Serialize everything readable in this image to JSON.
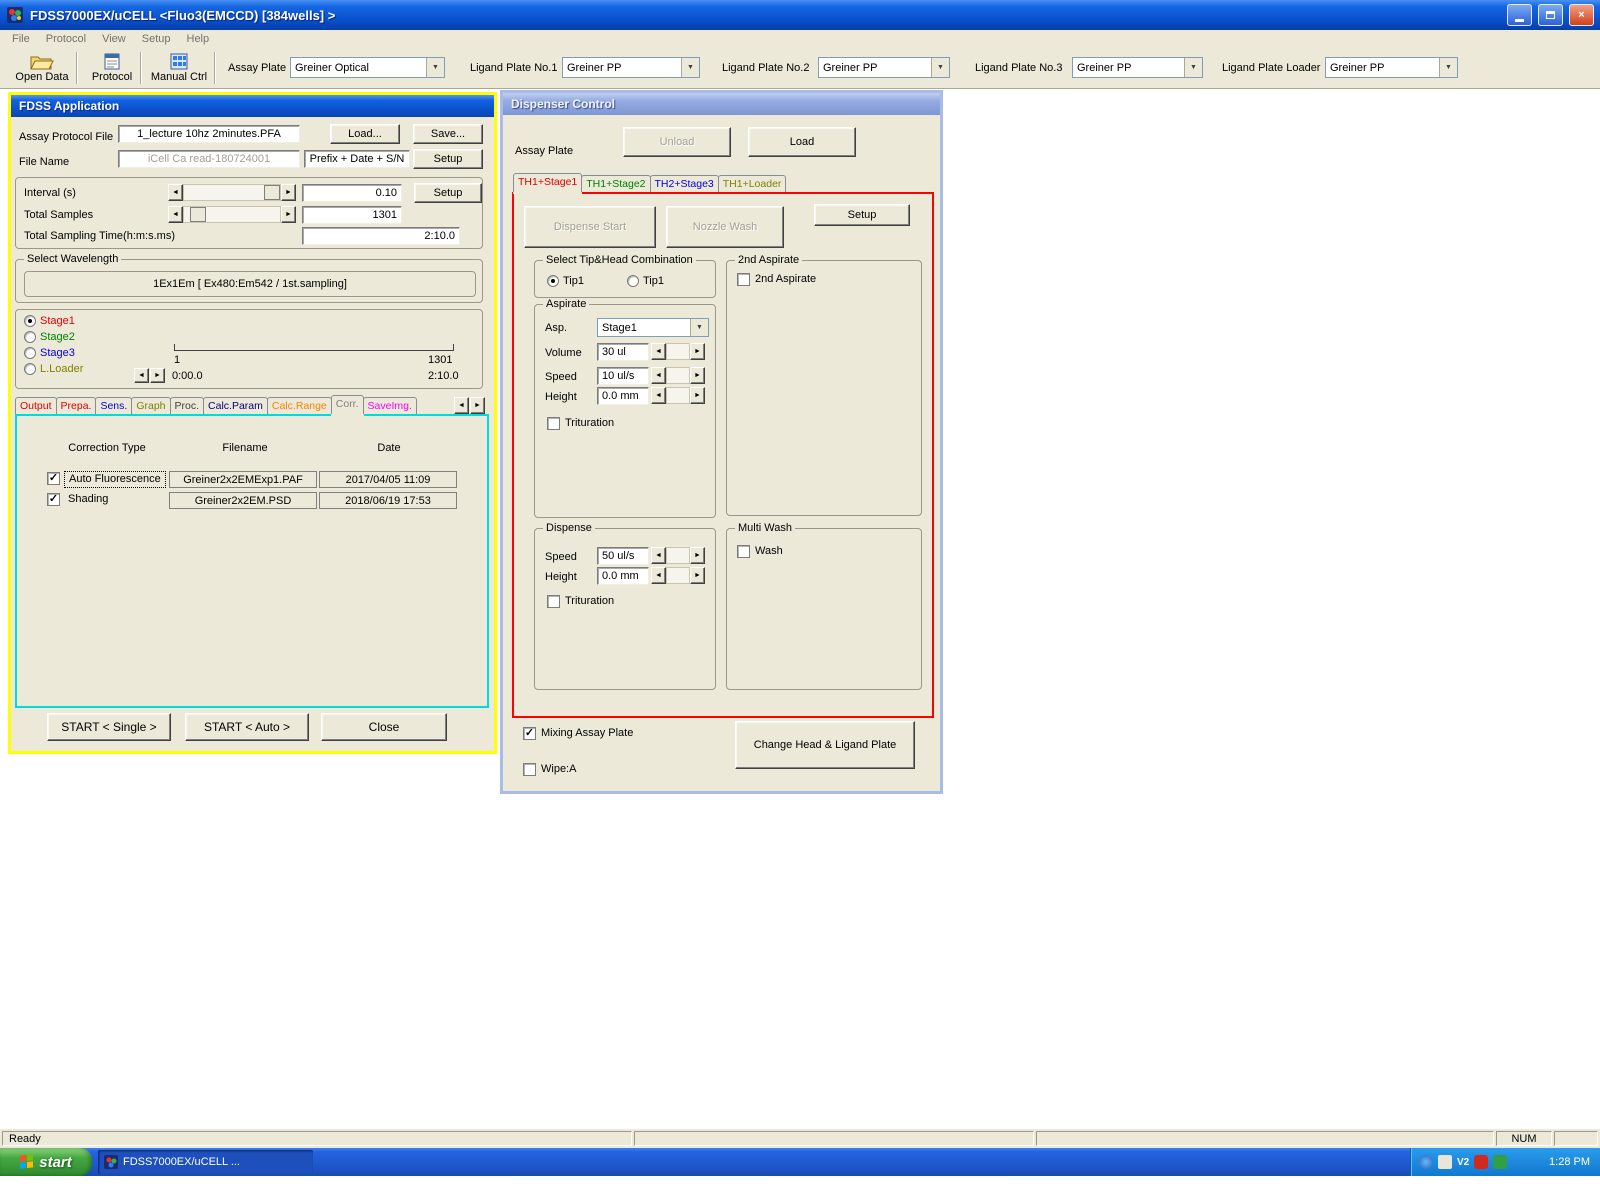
{
  "titlebar": {
    "title": "FDSS7000EX/uCELL <Fluo3(EMCCD) [384wells] >"
  },
  "menubar": {
    "items": [
      "File",
      "Protocol",
      "View",
      "Setup",
      "Help"
    ]
  },
  "toolbar": {
    "open_data": "Open Data",
    "protocol": "Protocol",
    "manual_ctrl": "Manual Ctrl",
    "combos": [
      {
        "label": "Assay Plate",
        "value": "Greiner Optical"
      },
      {
        "label": "Ligand Plate No.1",
        "value": "Greiner PP"
      },
      {
        "label": "Ligand Plate No.2",
        "value": "Greiner PP"
      },
      {
        "label": "Ligand Plate No.3",
        "value": "Greiner PP"
      },
      {
        "label": "Ligand Plate Loader",
        "value": "Greiner PP"
      }
    ]
  },
  "fdss": {
    "title": "FDSS Application",
    "protocol_file": {
      "label": "Assay Protocol File",
      "value": "1_lecture 10hz 2minutes.PFA",
      "load": "Load...",
      "save": "Save..."
    },
    "file_name": {
      "label": "File Name",
      "value": "iCell Ca read-180724001",
      "prefix": "Prefix + Date + S/N",
      "setup": "Setup"
    },
    "interval": {
      "label": "Interval (s)",
      "value": "0.10",
      "setup": "Setup"
    },
    "total_samples": {
      "label": "Total Samples",
      "value": "1301"
    },
    "total_time": {
      "label": "Total Sampling Time(h:m:s.ms)",
      "value": "2:10.0"
    },
    "wavelength": {
      "group": "Select Wavelength",
      "value": "1Ex1Em [ Ex480:Em542 / 1st.sampling]"
    },
    "stages": [
      {
        "label": "Stage1",
        "color": "#e00000",
        "selected": true
      },
      {
        "label": "Stage2",
        "color": "#008000",
        "selected": false
      },
      {
        "label": "Stage3",
        "color": "#0000e0",
        "selected": false
      },
      {
        "label": "L.Loader",
        "color": "#808000",
        "selected": false
      }
    ],
    "timeline": {
      "start_index": "1",
      "end_index": "1301",
      "start_time": "0:00.0",
      "end_time": "2:10.0"
    },
    "tabs": [
      {
        "label": "Output",
        "color": "#e00000",
        "selected": false
      },
      {
        "label": "Prepa.",
        "color": "#e00000",
        "selected": false
      },
      {
        "label": "Sens.",
        "color": "#0000e0",
        "selected": false
      },
      {
        "label": "Graph",
        "color": "#808000",
        "selected": false
      },
      {
        "label": "Proc.",
        "color": "#404040",
        "selected": false
      },
      {
        "label": "Calc.Param",
        "color": "#000080",
        "selected": false
      },
      {
        "label": "Calc.Range",
        "color": "#ff8000",
        "selected": false
      },
      {
        "label": "Corr.",
        "color": "#808080",
        "selected": true
      },
      {
        "label": "SaveImg.",
        "color": "#ff00ff",
        "selected": false
      }
    ],
    "correction": {
      "headers": [
        "Correction Type",
        "Filename",
        "Date"
      ],
      "rows": [
        {
          "label": "Auto Fluorescence",
          "checked": true,
          "filename": "Greiner2x2EMExp1.PAF",
          "date": "2017/04/05 11:09"
        },
        {
          "label": "Shading",
          "checked": true,
          "filename": "Greiner2x2EM.PSD",
          "date": "2018/06/19 17:53"
        }
      ]
    },
    "footer": {
      "start_single": "START < Single >",
      "start_auto": "START < Auto >",
      "close": "Close"
    }
  },
  "dispenser": {
    "title": "Dispenser Control",
    "assay_plate_label": "Assay Plate",
    "unload": "Unload",
    "load": "Load",
    "tabs": [
      {
        "label": "TH1+Stage1",
        "color": "#e00000",
        "selected": true
      },
      {
        "label": "TH1+Stage2",
        "color": "#008000",
        "selected": false
      },
      {
        "label": "TH2+Stage3",
        "color": "#0000e0",
        "selected": false
      },
      {
        "label": "TH1+Loader",
        "color": "#808000",
        "selected": false
      }
    ],
    "dispense_start": "Dispense Start",
    "nozzle_wash": "Nozzle Wash",
    "setup": "Setup",
    "tip_head": {
      "group": "Select Tip&Head Combination",
      "option1": "Tip1",
      "option2": "Tip1",
      "selected1": true,
      "selected2": false
    },
    "second_aspirate": {
      "group": "2nd Aspirate",
      "checkbox": "2nd Aspirate",
      "checked": false
    },
    "aspirate": {
      "group": "Aspirate",
      "asp_label": "Asp.",
      "asp_value": "Stage1",
      "volume_label": "Volume",
      "volume_value": "30 ul",
      "speed_label": "Speed",
      "speed_value": "10 ul/s",
      "height_label": "Height",
      "height_value": "0.0 mm",
      "trituration": "Trituration",
      "trituration_checked": false
    },
    "dispense": {
      "group": "Dispense",
      "speed_label": "Speed",
      "speed_value": "50 ul/s",
      "height_label": "Height",
      "height_value": "0.0 mm",
      "trituration": "Trituration",
      "trituration_checked": false
    },
    "multi_wash": {
      "group": "Multi Wash",
      "checkbox": "Wash",
      "checked": false
    },
    "mixing": {
      "label": "Mixing Assay Plate",
      "checked": true
    },
    "wipe": {
      "label": "Wipe:A",
      "checked": false
    },
    "change_button": "Change Head & Ligand Plate"
  },
  "statusbar": {
    "status": "Ready",
    "num": "NUM"
  },
  "taskbar": {
    "start": "start",
    "task": "FDSS7000EX/uCELL ...",
    "time": "1:28 PM",
    "tray_badge": "V2"
  },
  "icons": {
    "dropdown": "▼",
    "left_arrow": "◄",
    "right_arrow": "►",
    "check": "✓",
    "close": "×"
  },
  "colors": {
    "active_window_highlight": "#ffff00",
    "dispenser_highlight": "#ff0000",
    "tab_content_highlight": "#00dcdc"
  }
}
